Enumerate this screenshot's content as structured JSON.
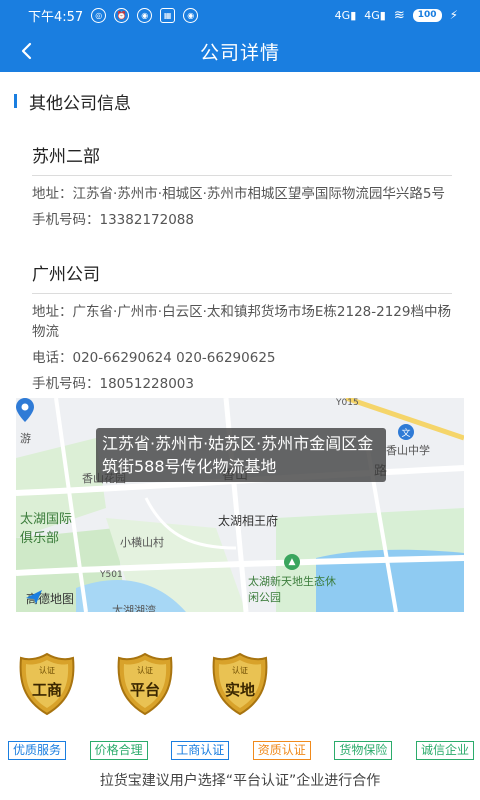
{
  "status_bar": {
    "time": "下午4:57",
    "signal1": "4G",
    "signal2": "4G",
    "battery": "100"
  },
  "navbar": {
    "back_icon": "chevron-left-icon",
    "title": "公司详情"
  },
  "section_title": "其他公司信息",
  "companies": [
    {
      "name": "苏州二部",
      "address": "地址：江苏省·苏州市·相城区·苏州市相城区望亭国际物流园华兴路5号",
      "mobile": "手机号码：13382172088"
    },
    {
      "name": "广州公司",
      "address": "地址：广东省·广州市·白云区·太和镇邦货场市场E栋2128-2129档中杨物流",
      "phone": "电话：020-66290624 020-66290625",
      "mobile": "手机号码：18051228003"
    }
  ],
  "map": {
    "tooltip": "江苏省·苏州市·姑苏区·苏州市金阊区金筑街588号传化物流基地",
    "labels": {
      "shan": "山",
      "you": "游",
      "y015": "Y015",
      "wen": "文",
      "xiangshan_school": "香山中学",
      "xianghua_garden": "香山花园",
      "xiang": "香山",
      "lu": "路",
      "taihu_xiang": "太湖相王府",
      "taihu_club": "太湖国际俱乐部",
      "xiaohengshan": "小横山村",
      "y501": "Y501",
      "taihu_park": "太湖新天地生态休闲公园",
      "amap": "高德地图",
      "taihu_bay": "太湖湖湾"
    }
  },
  "badges": [
    {
      "top": "认证",
      "main": "工商"
    },
    {
      "top": "认证",
      "main": "平台"
    },
    {
      "top": "认证",
      "main": "实地"
    }
  ],
  "tags": [
    {
      "label": "优质服务",
      "color": "#1a7ee0"
    },
    {
      "label": "价格合理",
      "color": "#2bab6b"
    },
    {
      "label": "工商认证",
      "color": "#1a7ee0"
    },
    {
      "label": "资质认证",
      "color": "#f08a1c"
    },
    {
      "label": "货物保险",
      "color": "#2bab6b"
    },
    {
      "label": "诚信企业",
      "color": "#2bab6b"
    }
  ],
  "footer": "拉货宝建议用户选择“平台认证”企业进行合作",
  "colors": {
    "primary": "#1a7ee0",
    "gold": "#d8a22a"
  }
}
